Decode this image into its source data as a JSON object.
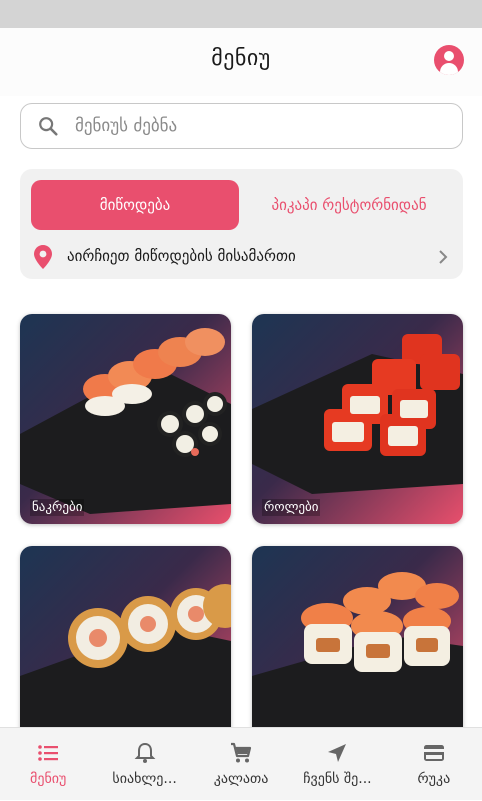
{
  "header": {
    "title": "მენიუ"
  },
  "search": {
    "placeholder": "მენიუს ძებნა"
  },
  "delivery": {
    "tabs": [
      {
        "label": "მიწოდება",
        "active": true
      },
      {
        "label": "პიკაპი რესტორნიდან",
        "active": false
      }
    ],
    "address_prompt": "აირჩიეთ მიწოდების მისამართი"
  },
  "categories": [
    {
      "label": "ნაკრები"
    },
    {
      "label": "როლები"
    },
    {
      "label": ""
    },
    {
      "label": ""
    }
  ],
  "bottom_nav": [
    {
      "label": "მენიუ",
      "icon": "list-icon",
      "active": true
    },
    {
      "label": "სიახლე...",
      "icon": "bell-icon",
      "active": false
    },
    {
      "label": "კალათა",
      "icon": "cart-icon",
      "active": false
    },
    {
      "label": "ჩვენს შე...",
      "icon": "location-arrow-icon",
      "active": false
    },
    {
      "label": "რუკა",
      "icon": "card-icon",
      "active": false
    }
  ],
  "colors": {
    "accent": "#e94f6e",
    "card_bg": "#f1f1f1",
    "nav_bg": "#f4f4f4"
  }
}
